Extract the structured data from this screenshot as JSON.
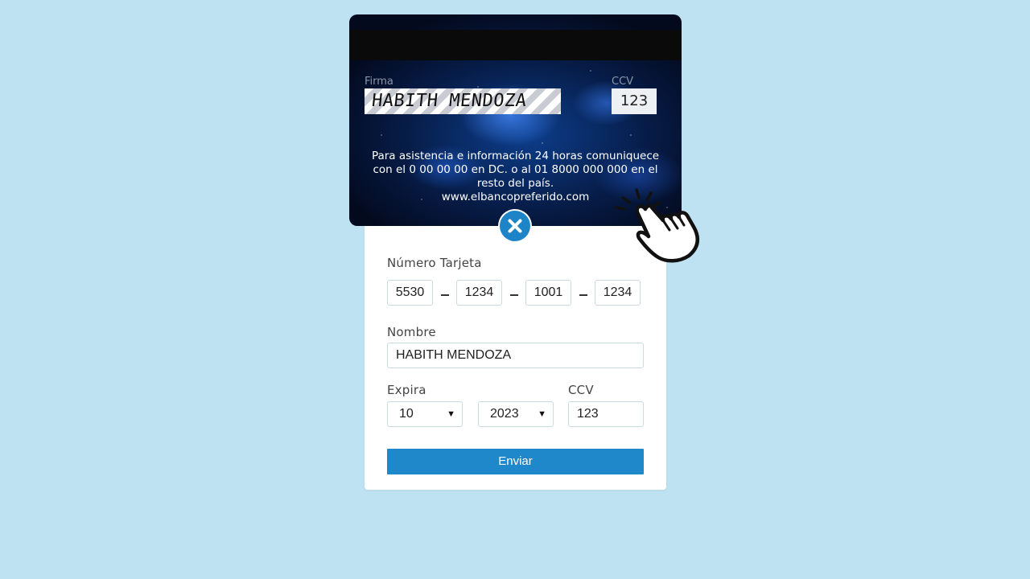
{
  "card_back": {
    "signature_label": "Firma",
    "signature_value": "HABITH MENDOZA",
    "ccv_label": "CCV",
    "ccv_value": "123",
    "info_text": "Para asistencia e información 24 horas comuniquece con el 0 00 00 00 en DC. o al 01 8000 000 000 en el resto del país.",
    "url": "www.elbancopreferido.com"
  },
  "close_button": {
    "icon": "close-icon",
    "color": "#1e84c8"
  },
  "form": {
    "card_number_label": "Número Tarjeta",
    "card_number_groups": [
      "5530",
      "1234",
      "1001",
      "1234"
    ],
    "name_label": "Nombre",
    "name_value": "HABITH MENDOZA",
    "expires_label": "Expira",
    "month_value": "10",
    "year_value": "2023",
    "ccv_label": "CCV",
    "ccv_value": "123",
    "submit_label": "Enviar"
  },
  "colors": {
    "background": "#bee2f1",
    "accent": "#1e88cb"
  }
}
